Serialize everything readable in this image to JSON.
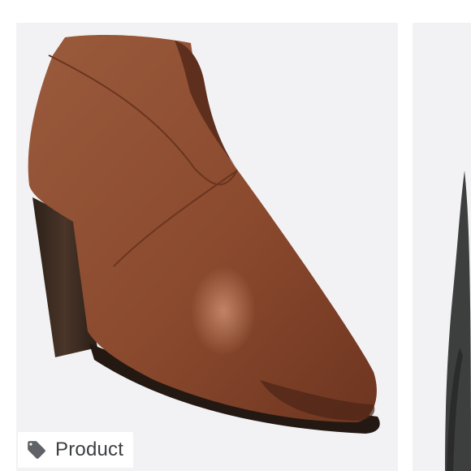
{
  "results": [
    {
      "label": "Product",
      "icon": "tag-icon",
      "image": "brown-leather-ankle-boot"
    },
    {
      "image": "dark-grey-boot-partial"
    }
  ],
  "colors": {
    "card_background": "#f2f2f4",
    "boot_leather": "#8a4a30",
    "heel": "#3a2a22",
    "badge_background": "#ffffff",
    "badge_text": "#3c4043"
  }
}
